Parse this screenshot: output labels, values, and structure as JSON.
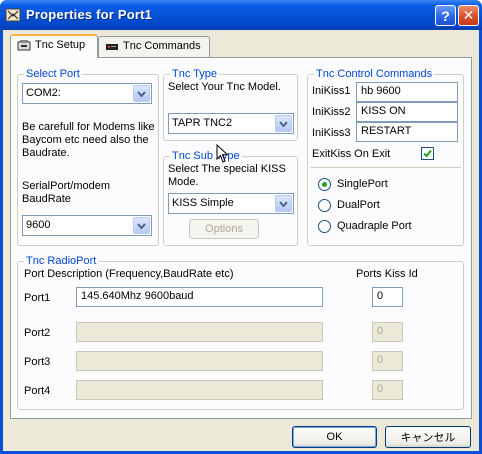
{
  "window": {
    "title": "Properties for Port1",
    "help_label": "?",
    "close_label": "✕"
  },
  "tabs": [
    {
      "label": "Tnc Setup",
      "active": true
    },
    {
      "label": "Tnc Commands",
      "active": false
    }
  ],
  "select_port": {
    "title": "Select Port",
    "port_value": "COM2:",
    "warning": [
      "Be carefull for Modems like",
      "Baycom etc need also the",
      "Baudrate."
    ],
    "baud_label": [
      "SerialPort/modem",
      "BaudRate"
    ],
    "baud_value": "9600"
  },
  "tnc_type": {
    "title": "Tnc Type",
    "prompt": "Select Your Tnc Model.",
    "value": "TAPR TNC2"
  },
  "tnc_sub_type": {
    "title": "Tnc Sub Type",
    "prompt": [
      "Select The special KISS",
      "Mode."
    ],
    "value": "KISS Simple",
    "options_button": "Options"
  },
  "control_commands": {
    "title": "Tnc Control Commands",
    "inikiss": [
      {
        "label": "IniKiss1",
        "value": "hb 9600"
      },
      {
        "label": "IniKiss2",
        "value": "KISS ON"
      },
      {
        "label": "IniKiss3",
        "value": "RESTART"
      }
    ],
    "exit_kiss_label": "ExitKiss On Exit",
    "exit_kiss_checked": true,
    "port_modes": [
      {
        "label": "SinglePort",
        "selected": true
      },
      {
        "label": "DualPort",
        "selected": false
      },
      {
        "label": "Quadraple Port",
        "selected": false
      }
    ]
  },
  "radio_port": {
    "title": "Tnc RadioPort",
    "desc_header": "Port Description (Frequency,BaudRate etc)",
    "kiss_header": "Ports Kiss Id",
    "ports": [
      {
        "label": "Port1",
        "description": "145.640Mhz 9600baud",
        "kiss_id": "0",
        "enabled": true
      },
      {
        "label": "Port2",
        "description": "",
        "kiss_id": "0",
        "enabled": false
      },
      {
        "label": "Port3",
        "description": "",
        "kiss_id": "0",
        "enabled": false
      },
      {
        "label": "Port4",
        "description": "",
        "kiss_id": "0",
        "enabled": false
      }
    ]
  },
  "footer": {
    "ok_label": "OK",
    "cancel_label": "キャンセル"
  }
}
